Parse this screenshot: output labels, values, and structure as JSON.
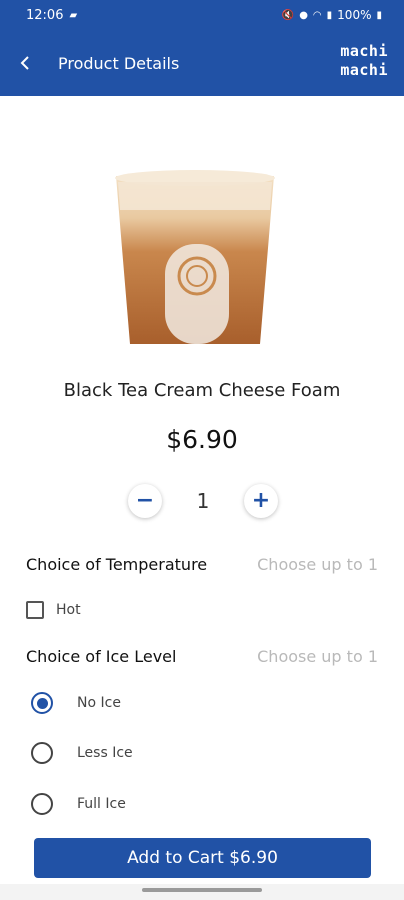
{
  "status_bar": {
    "time": "12:06",
    "battery": "100%",
    "left_icon": "notification-icon",
    "right_icons": [
      "mute-icon",
      "location-icon",
      "wifi-icon",
      "signal-icon",
      "battery-icon"
    ]
  },
  "header": {
    "title": "Product Details",
    "logo_line1": "machi",
    "logo_line2": "machi",
    "back_icon": "chevron-left-icon"
  },
  "product": {
    "name": "Black Tea Cream Cheese Foam",
    "price": "$6.90",
    "quantity": "1",
    "decrement": "−",
    "increment": "+"
  },
  "temperature": {
    "title": "Choice of Temperature",
    "hint": "Choose up to 1",
    "options": [
      {
        "label": "Hot",
        "checked": false
      }
    ]
  },
  "ice_level": {
    "title": "Choice of Ice Level",
    "hint": "Choose up to 1",
    "options": [
      {
        "label": "No Ice",
        "selected": true
      },
      {
        "label": "Less Ice",
        "selected": false
      },
      {
        "label": "Full Ice",
        "selected": false
      }
    ]
  },
  "cart": {
    "label": "Add to Cart $6.90"
  },
  "colors": {
    "primary": "#2152a6",
    "hint": "#b9b9b9"
  }
}
